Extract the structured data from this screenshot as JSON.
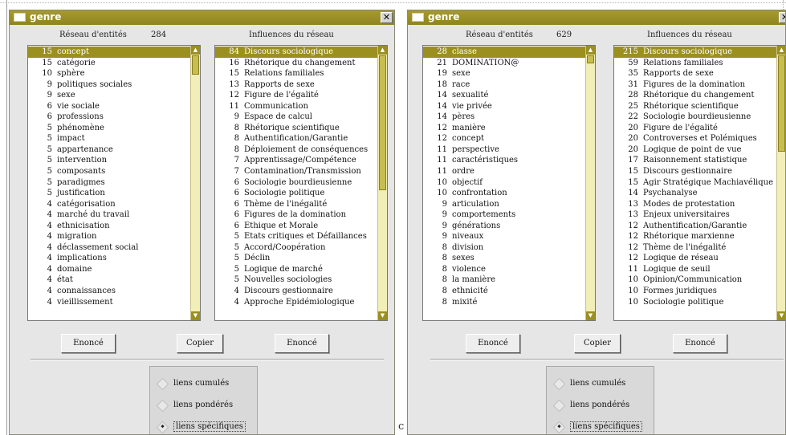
{
  "windows": [
    {
      "title": "genre",
      "close": "✕",
      "entities_label": "Réseau d'entités",
      "entities_count": "284",
      "influences_label": "Influences du réseau",
      "left_list": [
        {
          "count": "15",
          "label": "concept",
          "selected": true
        },
        {
          "count": "15",
          "label": "catégorie"
        },
        {
          "count": "10",
          "label": "sphère"
        },
        {
          "count": "9",
          "label": "politiques sociales"
        },
        {
          "count": "9",
          "label": "sexe"
        },
        {
          "count": "6",
          "label": "vie sociale"
        },
        {
          "count": "6",
          "label": "professions"
        },
        {
          "count": "5",
          "label": "phénomène"
        },
        {
          "count": "5",
          "label": "impact"
        },
        {
          "count": "5",
          "label": "appartenance"
        },
        {
          "count": "5",
          "label": "intervention"
        },
        {
          "count": "5",
          "label": "composants"
        },
        {
          "count": "5",
          "label": "paradigmes"
        },
        {
          "count": "5",
          "label": "justification"
        },
        {
          "count": "4",
          "label": "catégorisation"
        },
        {
          "count": "4",
          "label": "marché du travail"
        },
        {
          "count": "4",
          "label": "ethnicisation"
        },
        {
          "count": "4",
          "label": "migration"
        },
        {
          "count": "4",
          "label": "déclassement social"
        },
        {
          "count": "4",
          "label": "implications"
        },
        {
          "count": "4",
          "label": "domaine"
        },
        {
          "count": "4",
          "label": "état"
        },
        {
          "count": "4",
          "label": "connaissances"
        },
        {
          "count": "4",
          "label": "vieillissement"
        }
      ],
      "right_list": [
        {
          "count": "84",
          "label": "Discours sociologique",
          "selected": true
        },
        {
          "count": "16",
          "label": "Rhétorique du changement"
        },
        {
          "count": "15",
          "label": "Relations familiales"
        },
        {
          "count": "13",
          "label": "Rapports de sexe"
        },
        {
          "count": "12",
          "label": "Figure de l'égalité"
        },
        {
          "count": "11",
          "label": "Communication"
        },
        {
          "count": "9",
          "label": "Espace de calcul"
        },
        {
          "count": "8",
          "label": "Rhétorique scientifique"
        },
        {
          "count": "8",
          "label": "Authentification/Garantie"
        },
        {
          "count": "8",
          "label": "Déploiement de conséquences"
        },
        {
          "count": "7",
          "label": "Apprentissage/Compétence"
        },
        {
          "count": "7",
          "label": "Contamination/Transmission"
        },
        {
          "count": "6",
          "label": "Sociologie bourdieusienne"
        },
        {
          "count": "6",
          "label": "Sociologie politique"
        },
        {
          "count": "6",
          "label": "Thème de l'inégalité"
        },
        {
          "count": "6",
          "label": "Figures de la domination"
        },
        {
          "count": "6",
          "label": "Ethique et Morale"
        },
        {
          "count": "5",
          "label": "Etats critiques et Défaillances"
        },
        {
          "count": "5",
          "label": "Accord/Coopération"
        },
        {
          "count": "5",
          "label": "Déclin"
        },
        {
          "count": "5",
          "label": "Logique de marché"
        },
        {
          "count": "5",
          "label": "Nouvelles sociologies"
        },
        {
          "count": "4",
          "label": "Discours gestionnaire"
        },
        {
          "count": "4",
          "label": "Approche Epidémiologique"
        }
      ],
      "btn_left": "Enoncé",
      "btn_copy": "Copier",
      "btn_right": "Enoncé",
      "radios": [
        {
          "label": "liens cumulés",
          "checked": false
        },
        {
          "label": "liens pondérés",
          "checked": false
        },
        {
          "label": "liens spécifiques",
          "checked": true
        }
      ]
    },
    {
      "title": "genre",
      "close": "✕",
      "entities_label": "Réseau d'entités",
      "entities_count": "629",
      "influences_label": "Influences du réseau",
      "left_list": [
        {
          "count": "28",
          "label": "classe",
          "selected": true
        },
        {
          "count": "21",
          "label": "DOMINATION@"
        },
        {
          "count": "19",
          "label": "sexe"
        },
        {
          "count": "18",
          "label": "race"
        },
        {
          "count": "14",
          "label": "sexualité"
        },
        {
          "count": "14",
          "label": "vie privée"
        },
        {
          "count": "14",
          "label": "pères"
        },
        {
          "count": "12",
          "label": "manière"
        },
        {
          "count": "12",
          "label": "concept"
        },
        {
          "count": "11",
          "label": "perspective"
        },
        {
          "count": "11",
          "label": "caractéristiques"
        },
        {
          "count": "11",
          "label": "ordre"
        },
        {
          "count": "10",
          "label": "objectif"
        },
        {
          "count": "10",
          "label": "confrontation"
        },
        {
          "count": "9",
          "label": "articulation"
        },
        {
          "count": "9",
          "label": "comportements"
        },
        {
          "count": "9",
          "label": "générations"
        },
        {
          "count": "9",
          "label": "niveaux"
        },
        {
          "count": "8",
          "label": "division"
        },
        {
          "count": "8",
          "label": "sexes"
        },
        {
          "count": "8",
          "label": "violence"
        },
        {
          "count": "8",
          "label": "la manière"
        },
        {
          "count": "8",
          "label": "ethnicité"
        },
        {
          "count": "8",
          "label": "mixité"
        }
      ],
      "right_list": [
        {
          "count": "215",
          "label": "Discours sociologique",
          "selected": true
        },
        {
          "count": "59",
          "label": "Relations familiales"
        },
        {
          "count": "35",
          "label": "Rapports de sexe"
        },
        {
          "count": "31",
          "label": "Figures de la domination"
        },
        {
          "count": "28",
          "label": "Rhétorique du changement"
        },
        {
          "count": "25",
          "label": "Rhétorique scientifique"
        },
        {
          "count": "22",
          "label": "Sociologie bourdieusienne"
        },
        {
          "count": "20",
          "label": "Figure de l'égalité"
        },
        {
          "count": "20",
          "label": "Controverses et Polémiques"
        },
        {
          "count": "20",
          "label": "Logique de point de vue"
        },
        {
          "count": "17",
          "label": "Raisonnement statistique"
        },
        {
          "count": "15",
          "label": "Discours gestionnaire"
        },
        {
          "count": "15",
          "label": "Agir Stratégique Machiavélique"
        },
        {
          "count": "14",
          "label": "Psychanalyse"
        },
        {
          "count": "13",
          "label": "Modes de protestation"
        },
        {
          "count": "13",
          "label": "Enjeux universitaires"
        },
        {
          "count": "12",
          "label": "Authentification/Garantie"
        },
        {
          "count": "12",
          "label": "Rhétorique marxienne"
        },
        {
          "count": "12",
          "label": "Thème de l'inégalité"
        },
        {
          "count": "12",
          "label": "Logique de réseau"
        },
        {
          "count": "11",
          "label": "Logique de seuil"
        },
        {
          "count": "10",
          "label": "Opinion/Communication"
        },
        {
          "count": "10",
          "label": "Formes juridiques"
        },
        {
          "count": "10",
          "label": "Sociologie politique"
        }
      ],
      "btn_left": "Enoncé",
      "btn_copy": "Copier",
      "btn_right": "Enoncé",
      "radios": [
        {
          "label": "liens cumulés",
          "checked": false
        },
        {
          "label": "liens pondérés",
          "checked": false
        },
        {
          "label": "liens spécifiques",
          "checked": true
        }
      ]
    }
  ],
  "stray_char": "c",
  "colors": {
    "titlebar": "#9b8f20",
    "selection": "#9b8f20",
    "scrollbar_track": "#f2eeb8"
  }
}
